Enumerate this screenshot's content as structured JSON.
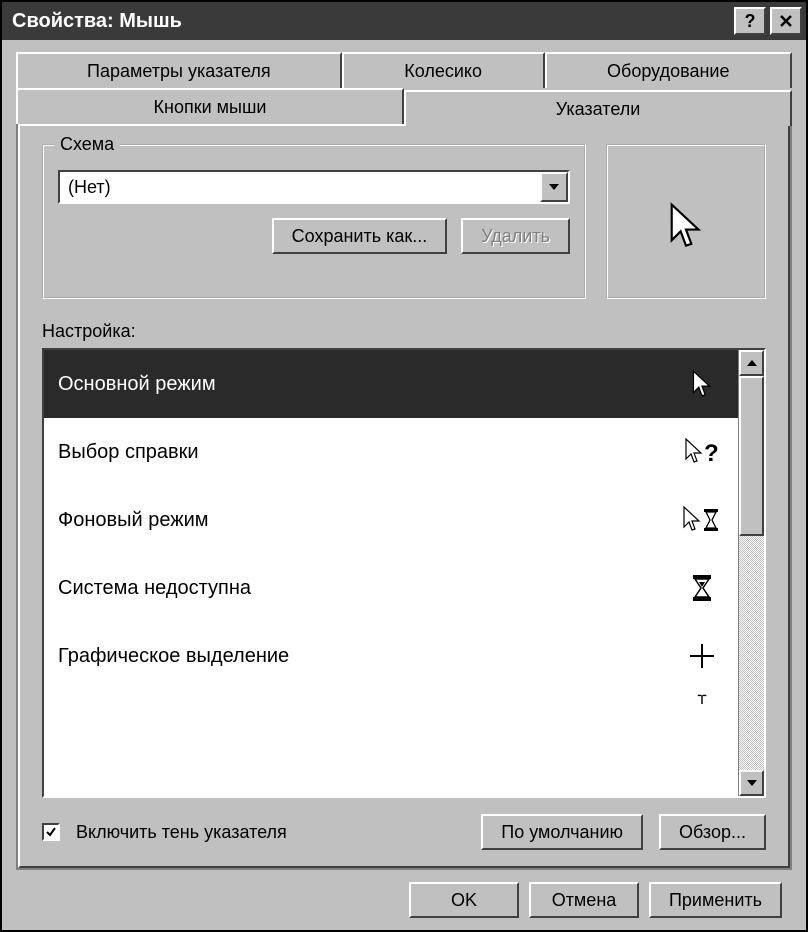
{
  "title": "Свойства: Мышь",
  "tabs_row1": [
    "Параметры указателя",
    "Колесико",
    "Оборудование"
  ],
  "tabs_row2": [
    "Кнопки мыши",
    "Указатели"
  ],
  "active_tab": "Указатели",
  "scheme": {
    "legend": "Схема",
    "value": "(Нет)",
    "save_as": "Сохранить как...",
    "delete": "Удалить"
  },
  "customize_label": "Настройка:",
  "cursor_list": [
    {
      "label": "Основной режим",
      "icon": "arrow",
      "selected": true
    },
    {
      "label": "Выбор справки",
      "icon": "arrow-help",
      "selected": false
    },
    {
      "label": "Фоновый режим",
      "icon": "arrow-hourglass",
      "selected": false
    },
    {
      "label": "Система недоступна",
      "icon": "hourglass",
      "selected": false
    },
    {
      "label": "Графическое выделение",
      "icon": "crosshair",
      "selected": false
    }
  ],
  "shadow_checkbox": {
    "label": "Включить тень указателя",
    "checked": true
  },
  "defaults_btn": "По умолчанию",
  "browse_btn": "Обзор...",
  "ok_btn": "OK",
  "cancel_btn": "Отмена",
  "apply_btn": "Применить"
}
